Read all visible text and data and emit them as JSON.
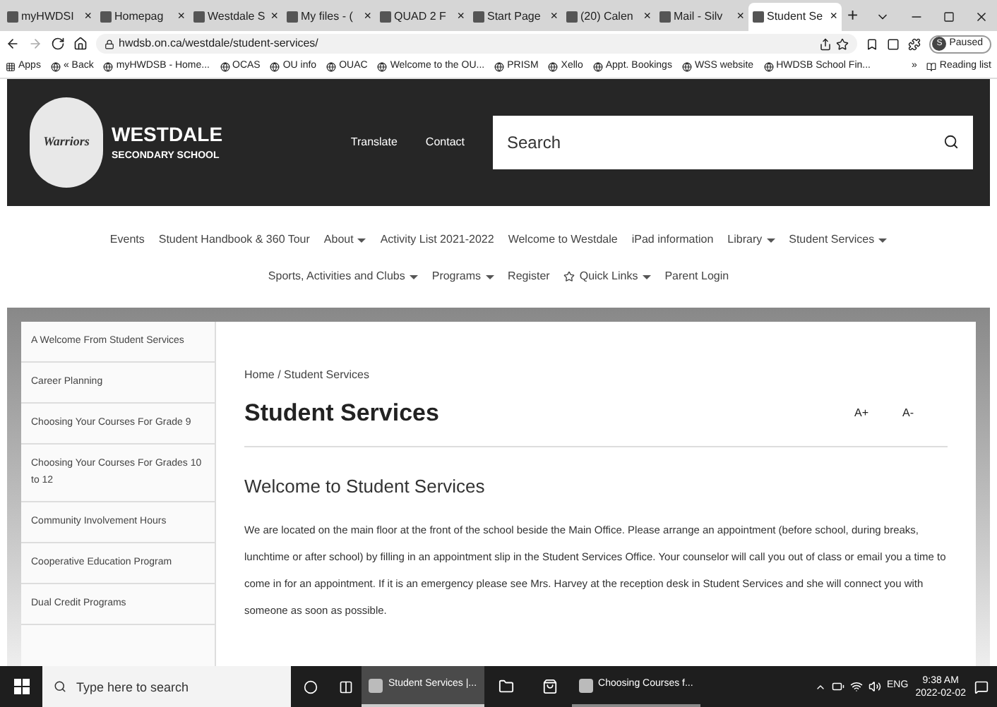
{
  "browser": {
    "tabs": [
      {
        "label": "myHWDSI",
        "selected": false
      },
      {
        "label": "Homepag",
        "selected": false
      },
      {
        "label": "Westdale S",
        "selected": false
      },
      {
        "label": "My files - (",
        "selected": false
      },
      {
        "label": "QUAD 2 F",
        "selected": false
      },
      {
        "label": "Start Page",
        "selected": false
      },
      {
        "label": "(20) Calen",
        "selected": false
      },
      {
        "label": "Mail - Silv",
        "selected": false
      },
      {
        "label": "Student Se",
        "selected": true
      }
    ],
    "close_glyph": "×",
    "new_tab": "+",
    "url": "hwdsb.on.ca/westdale/student-services/",
    "profile": {
      "initial": "S",
      "label": "Paused"
    },
    "bookmarks": [
      "Apps",
      "« Back",
      "myHWDSB - Home...",
      "OCAS",
      "OU info",
      "OUAC",
      "Welcome to the OU...",
      "PRISM",
      "Xello",
      "Appt. Bookings",
      "WSS website",
      "HWDSB School Fin..."
    ],
    "more_bookmarks": "»",
    "reading_list": "Reading list"
  },
  "header": {
    "logo_text": "Warriors",
    "school_name": "WESTDALE",
    "school_subtitle": "SECONDARY SCHOOL",
    "links": [
      "Translate",
      "Contact"
    ],
    "search": {
      "placeholder": "Search"
    }
  },
  "nav": {
    "lines": [
      {
        "items": [
          {
            "label": "Events",
            "dropdown": false
          },
          {
            "label": "Student Handbook & 360 Tour",
            "dropdown": false
          },
          {
            "label": "About",
            "dropdown": true
          },
          {
            "label": "Activity List 2021-2022",
            "dropdown": false
          },
          {
            "label": "Welcome to Westdale",
            "dropdown": false
          },
          {
            "label": "iPad information",
            "dropdown": false
          },
          {
            "label": "Library",
            "dropdown": true
          },
          {
            "label": "Student Services",
            "dropdown": true
          }
        ]
      },
      {
        "items": [
          {
            "label": "Sports, Activities and Clubs",
            "dropdown": true
          },
          {
            "label": "Programs",
            "dropdown": true
          },
          {
            "label": "Register",
            "dropdown": false
          },
          {
            "label": "Quick Links",
            "dropdown": true,
            "star": true
          },
          {
            "label": "Parent Login",
            "dropdown": false
          }
        ]
      }
    ]
  },
  "sidebar": {
    "items": [
      "A Welcome From Student Services",
      "Career Planning",
      "Choosing Your Courses For Grade 9",
      "Choosing Your Courses For Grades 10 to 12",
      "Community Involvement Hours",
      "Cooperative Education Program",
      "Dual Credit Programs"
    ]
  },
  "content": {
    "breadcrumb": "Home / Student Services",
    "title": "Student Services",
    "font_controls": [
      "A+",
      "A-"
    ],
    "heading": "Welcome to Student Services",
    "paragraph": "We are located on the main floor at the front of the school beside the Main Office.  Please arrange an appointment (before school, during breaks, lunchtime or after school) by filling in an appointment slip in the Student Services Office. Your counselor will call you out of class or email you a time to come in for an appointment. If it is an emergency please see Mrs. Harvey at the reception desk in Student Services and she will connect you with someone as soon as possible."
  },
  "taskbar": {
    "search": {
      "placeholder": "Type here to search"
    },
    "apps": [
      {
        "label": "Student Services |...",
        "selected": true
      },
      {
        "label": "Choosing Courses f...",
        "selected": false
      }
    ],
    "language": "ENG",
    "time": "9:38 AM",
    "date": "2022-02-02"
  }
}
